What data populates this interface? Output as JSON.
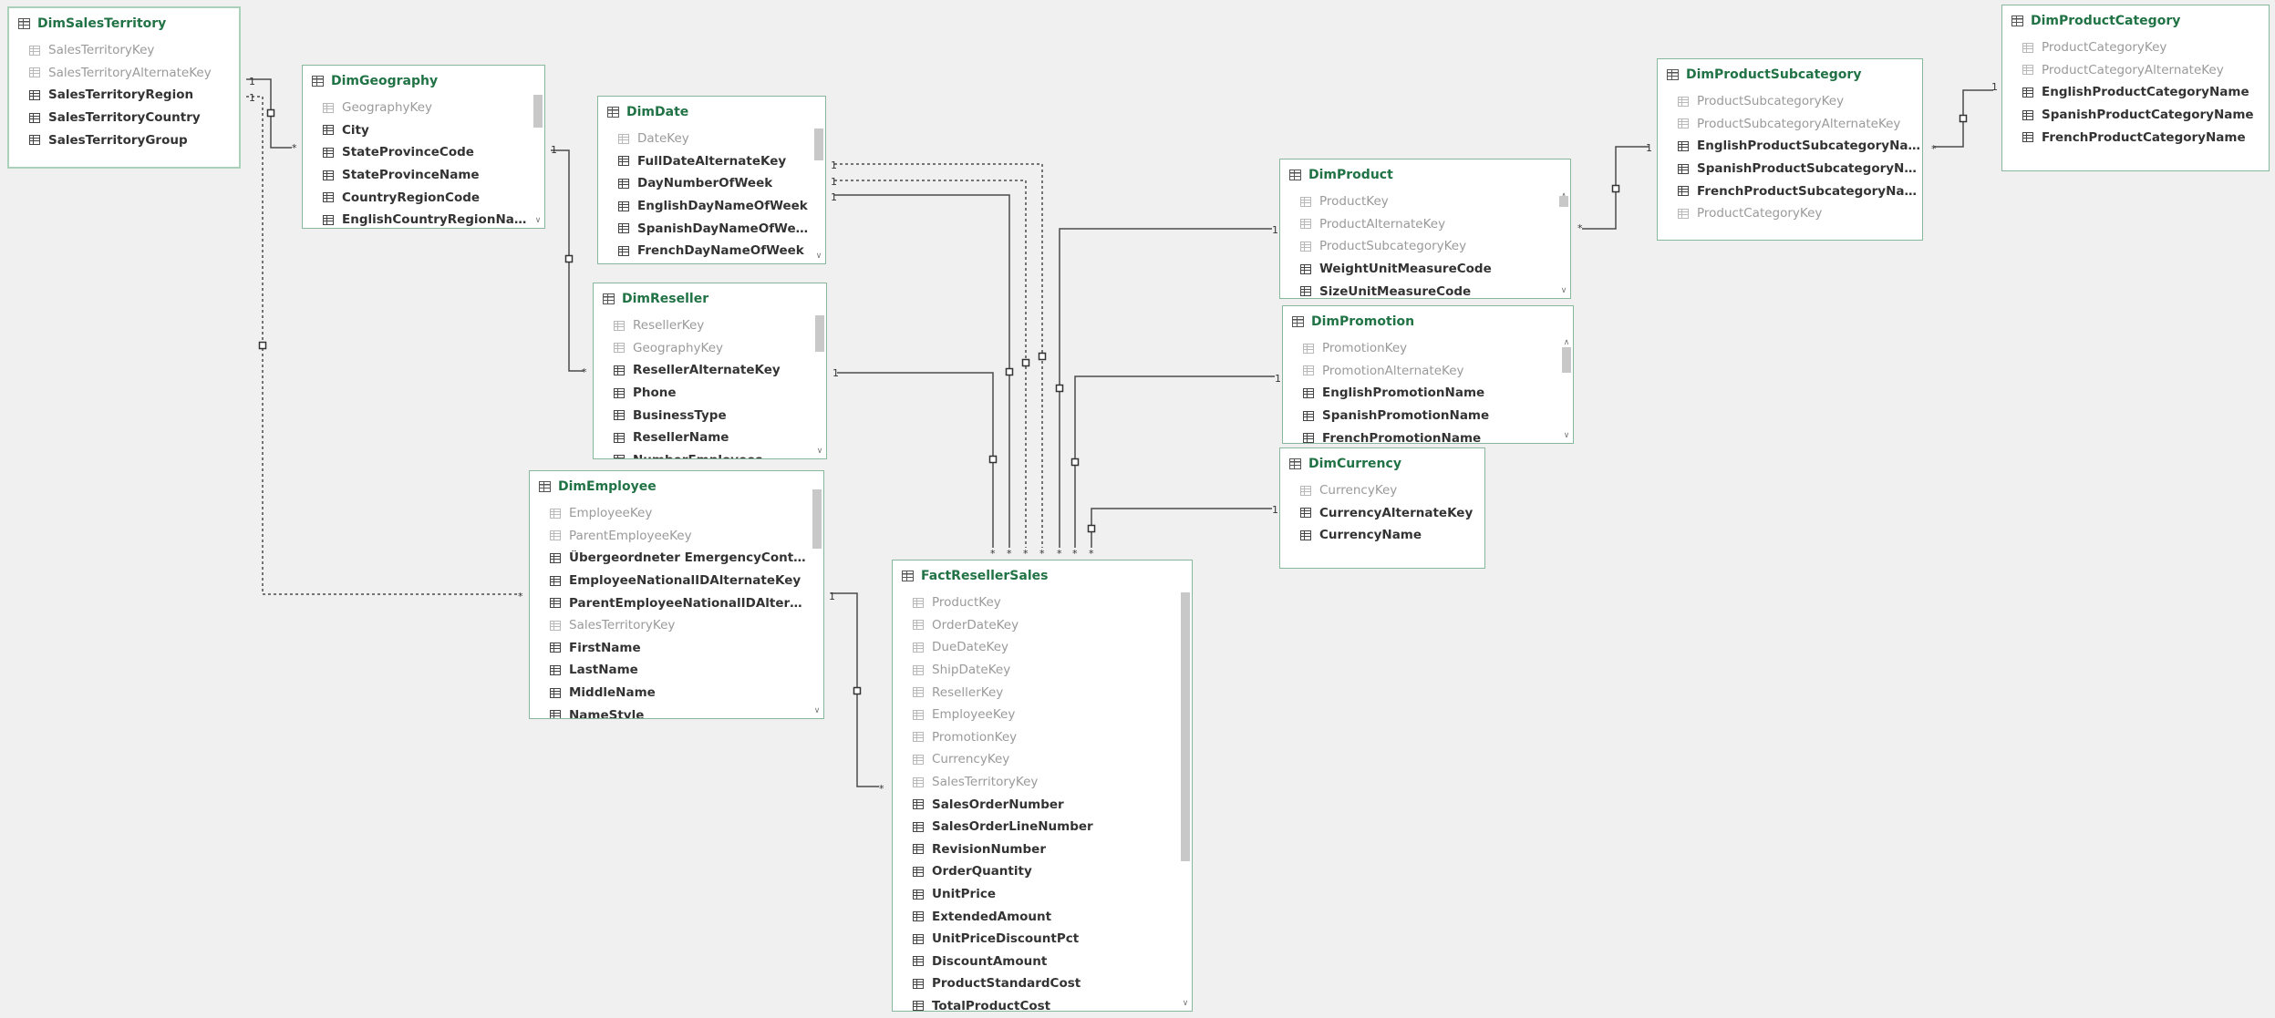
{
  "tables": [
    {
      "name": "DimSalesTerritory",
      "fields": [
        [
          "SalesTerritoryKey",
          1
        ],
        [
          "SalesTerritoryAlternateKey",
          1
        ],
        [
          "SalesTerritoryRegion",
          0
        ],
        [
          "SalesTerritoryCountry",
          0
        ],
        [
          "SalesTerritoryGroup",
          0
        ]
      ]
    },
    {
      "name": "DimGeography",
      "fields": [
        [
          "GeographyKey",
          1
        ],
        [
          "City",
          0
        ],
        [
          "StateProvinceCode",
          0
        ],
        [
          "StateProvinceName",
          0
        ],
        [
          "CountryRegionCode",
          0
        ],
        [
          "EnglishCountryRegionName",
          0
        ]
      ]
    },
    {
      "name": "DimDate",
      "fields": [
        [
          "DateKey",
          1
        ],
        [
          "FullDateAlternateKey",
          0
        ],
        [
          "DayNumberOfWeek",
          0
        ],
        [
          "EnglishDayNameOfWeek",
          0
        ],
        [
          "SpanishDayNameOfWeek",
          0
        ],
        [
          "FrenchDayNameOfWeek",
          0
        ]
      ]
    },
    {
      "name": "DimReseller",
      "fields": [
        [
          "ResellerKey",
          1
        ],
        [
          "GeographyKey",
          1
        ],
        [
          "ResellerAlternateKey",
          0
        ],
        [
          "Phone",
          0
        ],
        [
          "BusinessType",
          0
        ],
        [
          "ResellerName",
          0
        ],
        [
          "NumberEmployees",
          0
        ]
      ]
    },
    {
      "name": "DimEmployee",
      "fields": [
        [
          "EmployeeKey",
          1
        ],
        [
          "ParentEmployeeKey",
          1
        ],
        [
          "Übergeordneter EmergencyContactName",
          0
        ],
        [
          "EmployeeNationalIDAlternateKey",
          0
        ],
        [
          "ParentEmployeeNationalIDAlternateKey",
          0
        ],
        [
          "SalesTerritoryKey",
          1
        ],
        [
          "FirstName",
          0
        ],
        [
          "LastName",
          0
        ],
        [
          "MiddleName",
          0
        ],
        [
          "NameStyle",
          0
        ]
      ]
    },
    {
      "name": "FactResellerSales",
      "fields": [
        [
          "ProductKey",
          1
        ],
        [
          "OrderDateKey",
          1
        ],
        [
          "DueDateKey",
          1
        ],
        [
          "ShipDateKey",
          1
        ],
        [
          "ResellerKey",
          1
        ],
        [
          "EmployeeKey",
          1
        ],
        [
          "PromotionKey",
          1
        ],
        [
          "CurrencyKey",
          1
        ],
        [
          "SalesTerritoryKey",
          1
        ],
        [
          "SalesOrderNumber",
          0
        ],
        [
          "SalesOrderLineNumber",
          0
        ],
        [
          "RevisionNumber",
          0
        ],
        [
          "OrderQuantity",
          0
        ],
        [
          "UnitPrice",
          0
        ],
        [
          "ExtendedAmount",
          0
        ],
        [
          "UnitPriceDiscountPct",
          0
        ],
        [
          "DiscountAmount",
          0
        ],
        [
          "ProductStandardCost",
          0
        ],
        [
          "TotalProductCost",
          0
        ]
      ]
    },
    {
      "name": "DimProduct",
      "fields": [
        [
          "ProductKey",
          1
        ],
        [
          "ProductAlternateKey",
          1
        ],
        [
          "ProductSubcategoryKey",
          1
        ],
        [
          "WeightUnitMeasureCode",
          0
        ],
        [
          "SizeUnitMeasureCode",
          0
        ]
      ]
    },
    {
      "name": "DimPromotion",
      "fields": [
        [
          "PromotionKey",
          1
        ],
        [
          "PromotionAlternateKey",
          1
        ],
        [
          "EnglishPromotionName",
          0
        ],
        [
          "SpanishPromotionName",
          0
        ],
        [
          "FrenchPromotionName",
          0
        ]
      ]
    },
    {
      "name": "DimCurrency",
      "fields": [
        [
          "CurrencyKey",
          1
        ],
        [
          "CurrencyAlternateKey",
          0
        ],
        [
          "CurrencyName",
          0
        ]
      ]
    },
    {
      "name": "DimProductSubcategory",
      "fields": [
        [
          "ProductSubcategoryKey",
          1
        ],
        [
          "ProductSubcategoryAlternateKey",
          1
        ],
        [
          "EnglishProductSubcategoryName",
          0
        ],
        [
          "SpanishProductSubcategoryName",
          0
        ],
        [
          "FrenchProductSubcategoryName",
          0
        ],
        [
          "ProductCategoryKey",
          1
        ]
      ]
    },
    {
      "name": "DimProductCategory",
      "fields": [
        [
          "ProductCategoryKey",
          1
        ],
        [
          "ProductCategoryAlternateKey",
          1
        ],
        [
          "EnglishProductCategoryName",
          0
        ],
        [
          "SpanishProductCategoryName",
          0
        ],
        [
          "FrenchProductCategoryName",
          0
        ]
      ]
    }
  ],
  "relationships": [
    {
      "one": "DimSalesTerritory",
      "many": "DimGeography",
      "from_label": "1",
      "to_label": "*",
      "style": "solid"
    },
    {
      "one": "DimSalesTerritory",
      "many": "DimEmployee",
      "from_label": "1",
      "to_label": "*",
      "style": "dotted"
    },
    {
      "one": "DimGeography",
      "many": "DimReseller",
      "from_label": "1",
      "to_label": "*",
      "style": "solid"
    },
    {
      "one": "DimDate",
      "many": "FactResellerSales",
      "from_label": "1",
      "to_label": "*",
      "style": "dotted"
    },
    {
      "one": "DimDate",
      "many": "FactResellerSales",
      "from_label": "1",
      "to_label": "*",
      "style": "dotted"
    },
    {
      "one": "DimDate",
      "many": "FactResellerSales",
      "from_label": "1",
      "to_label": "*",
      "style": "solid"
    },
    {
      "one": "DimReseller",
      "many": "FactResellerSales",
      "from_label": "1",
      "to_label": "*",
      "style": "solid"
    },
    {
      "one": "DimEmployee",
      "many": "FactResellerSales",
      "from_label": "1",
      "to_label": "*",
      "style": "solid"
    },
    {
      "one": "DimProduct",
      "many": "FactResellerSales",
      "from_label": "1",
      "to_label": "*",
      "style": "solid"
    },
    {
      "one": "DimPromotion",
      "many": "FactResellerSales",
      "from_label": "1",
      "to_label": "*",
      "style": "solid"
    },
    {
      "one": "DimCurrency",
      "many": "FactResellerSales",
      "from_label": "1",
      "to_label": "*",
      "style": "solid"
    },
    {
      "one": "DimProductSubcategory",
      "many": "DimProduct",
      "from_label": "1",
      "to_label": "*",
      "style": "solid"
    },
    {
      "one": "DimProductCategory",
      "many": "DimProductSubcategory",
      "from_label": "1",
      "to_label": "*",
      "style": "solid"
    }
  ],
  "colors": {
    "canvas": "#f0f0f0",
    "table_border": "#87b89b",
    "table_title": "#217346",
    "field_text": "#333333",
    "key_text": "#9a9a9a",
    "line": "#4a4a4a"
  }
}
